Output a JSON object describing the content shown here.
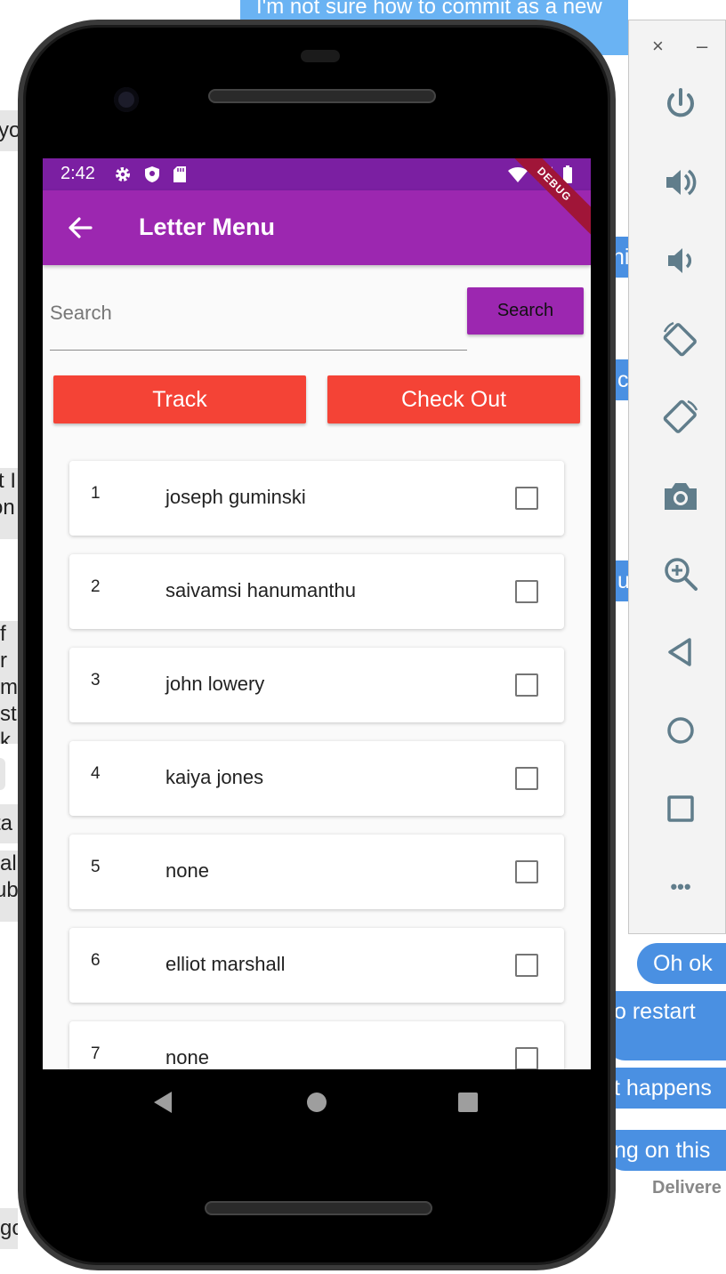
{
  "background": {
    "top_bubble": "I'm not sure how to commit as a new",
    "left_fragments": [
      "yo",
      "t I",
      "on",
      "f r",
      "me",
      "st",
      "k",
      "ta",
      "al",
      "ub",
      "go"
    ],
    "right_bubbles": [
      "Oh ok",
      "o restart",
      "t happens",
      "ng on this"
    ],
    "side_fragments": [
      "hi",
      "c",
      "u"
    ],
    "delivered": "Delivere"
  },
  "emulator_panel": {
    "close_glyph": "×",
    "minimize_glyph": "–",
    "buttons": [
      "power-icon",
      "volume-up-icon",
      "volume-down-icon",
      "rotate-left-icon",
      "rotate-right-icon",
      "camera-icon",
      "zoom-icon",
      "back-icon",
      "home-icon",
      "overview-icon",
      "more-icon"
    ],
    "more_glyph": "•••"
  },
  "status_bar": {
    "time": "2:42",
    "icons": [
      "settings-icon",
      "shield-icon",
      "sd-card-icon",
      "wifi-icon",
      "signal-icon",
      "battery-icon"
    ]
  },
  "app_bar": {
    "title": "Letter Menu",
    "debug_label": "DEBUG"
  },
  "search": {
    "placeholder": "Search",
    "value": "",
    "button_label": "Search"
  },
  "actions": {
    "track_label": "Track",
    "checkout_label": "Check Out"
  },
  "letters": [
    {
      "num": "1",
      "name": "joseph guminski",
      "checked": false
    },
    {
      "num": "2",
      "name": "saivamsi hanumanthu",
      "checked": false
    },
    {
      "num": "3",
      "name": "john lowery",
      "checked": false
    },
    {
      "num": "4",
      "name": "kaiya jones",
      "checked": false
    },
    {
      "num": "5",
      "name": "none",
      "checked": false
    },
    {
      "num": "6",
      "name": "elliot marshall",
      "checked": false
    },
    {
      "num": "7",
      "name": "none",
      "checked": false
    }
  ],
  "colors": {
    "status_bar": "#7b1fa2",
    "app_bar": "#9c27b0",
    "accent_red": "#f44336",
    "bubble_blue": "#4a90e2"
  }
}
